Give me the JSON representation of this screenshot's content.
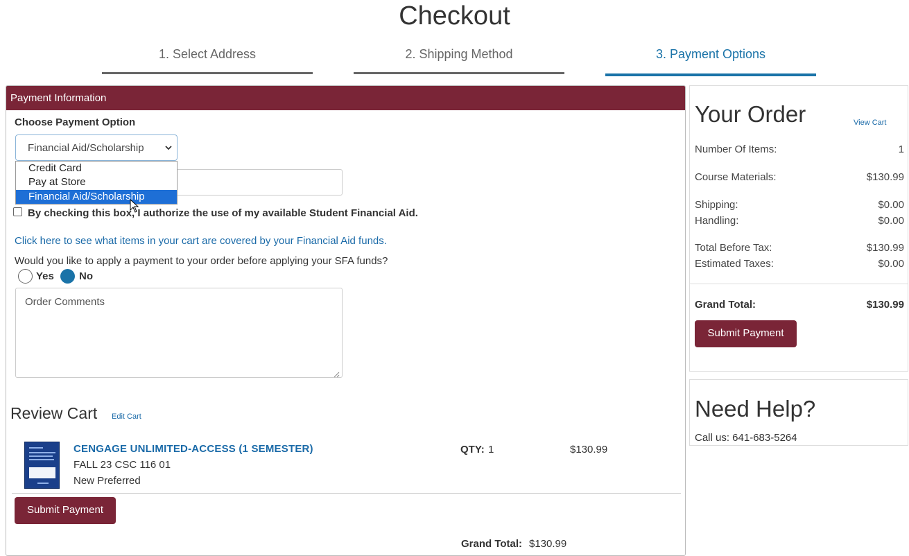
{
  "page": {
    "title": "Checkout"
  },
  "steps": [
    {
      "label": "1. Select Address",
      "active": false
    },
    {
      "label": "2. Shipping Method",
      "active": false
    },
    {
      "label": "3. Payment Options",
      "active": true
    }
  ],
  "payment": {
    "header": "Payment Information",
    "choose_label": "Choose Payment Option",
    "selected_option": "Financial Aid/Scholarship",
    "options": [
      "Credit Card",
      "Pay at Store",
      "Financial Aid/Scholarship"
    ],
    "authorize_label": "By checking this box, I authorize the use of my available Student Financial Aid.",
    "authorize_checked": false,
    "fa_link": "Click here to see what items in your cart are covered by your Financial Aid funds.",
    "sfa_question": "Would you like to apply a payment to your order before applying your SFA funds?",
    "radio_yes": "Yes",
    "radio_no": "No",
    "radio_selected": "No",
    "comments_placeholder": "Order Comments"
  },
  "cart": {
    "title": "Review Cart",
    "edit_link": "Edit Cart",
    "items": [
      {
        "name": "CENGAGE UNLIMITED-ACCESS (1 SEMESTER)",
        "course": "FALL 23 CSC 116 01",
        "condition": "New Preferred",
        "qty_label": "QTY:",
        "qty": "1",
        "price": "$130.99"
      }
    ],
    "submit_label": "Submit Payment",
    "grand_total_label": "Grand Total:",
    "grand_total_value": "$130.99"
  },
  "order_summary": {
    "title": "Your Order",
    "view_cart_link": "View Cart",
    "number_of_items_label": "Number Of Items:",
    "number_of_items": "1",
    "course_materials_label": "Course Materials:",
    "course_materials": "$130.99",
    "shipping_label": "Shipping:",
    "shipping": "$0.00",
    "handling_label": "Handling:",
    "handling": "$0.00",
    "total_before_tax_label": "Total Before Tax:",
    "total_before_tax": "$130.99",
    "estimated_taxes_label": "Estimated Taxes:",
    "estimated_taxes": "$0.00",
    "grand_total_label": "Grand Total:",
    "grand_total": "$130.99",
    "submit_label": "Submit Payment"
  },
  "help": {
    "title": "Need Help?",
    "phone": "Call us: 641-683-5264"
  },
  "colors": {
    "brand_maroon": "#7a2537",
    "accent_blue": "#1a73a8",
    "link_blue": "#1a6aa8",
    "dropdown_highlight": "#1e6fd6"
  }
}
